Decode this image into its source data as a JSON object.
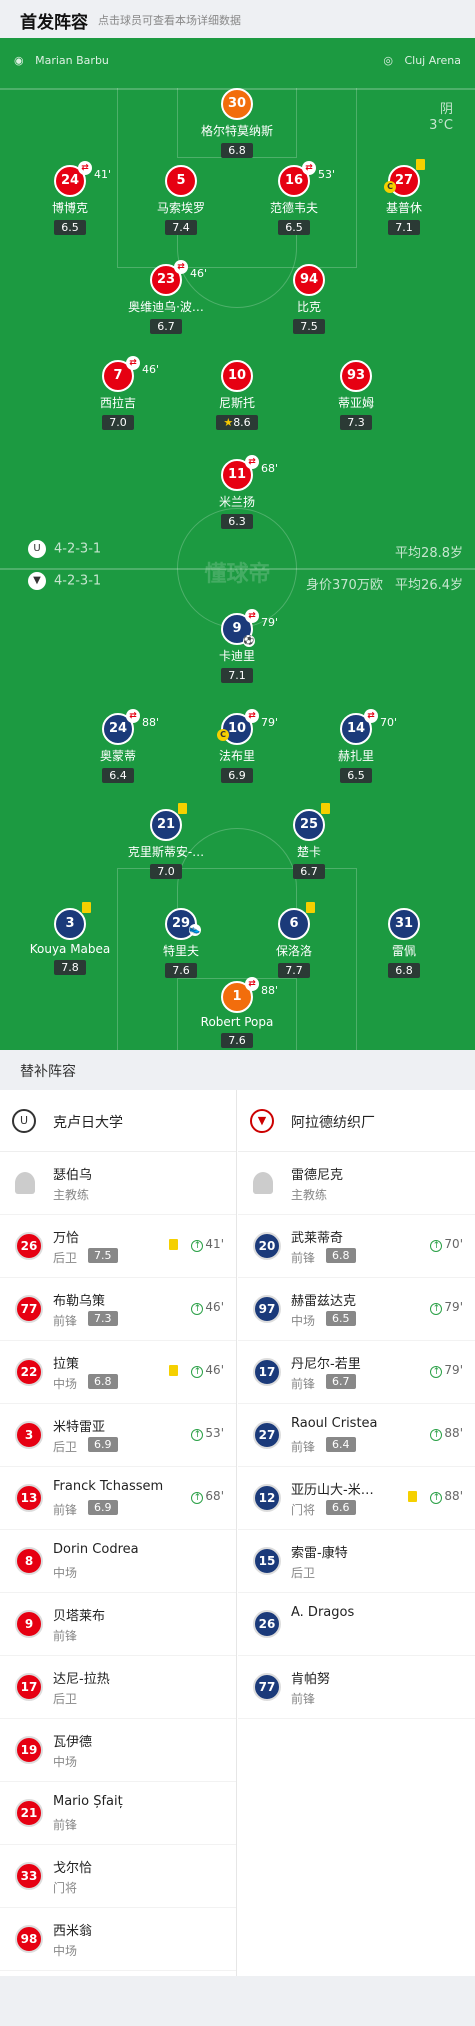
{
  "header": {
    "title": "首发阵容",
    "subtitle": "点击球员可查看本场详细数据"
  },
  "match": {
    "referee": "Marian Barbu",
    "stadium": "Cluj Arena",
    "weather": "阴",
    "temp": "3°C",
    "watermark": "懂球帝"
  },
  "home": {
    "formation": "4-2-3-1",
    "avg_age": "平均28.8岁",
    "name": "克卢日大学",
    "coach": "瑟伯乌",
    "coach_role": "主教练"
  },
  "away": {
    "formation": "4-2-3-1",
    "value": "身价370万欧",
    "avg_age": "平均26.4岁",
    "name": "阿拉德纺织厂",
    "coach": "雷德尼克",
    "coach_role": "主教练"
  },
  "lineup_home": [
    {
      "num": "30",
      "name": "格尔特莫纳斯",
      "rating": "6.8"
    },
    {
      "num": "24",
      "name": "博博克",
      "rating": "6.5",
      "sub_min": "41'"
    },
    {
      "num": "5",
      "name": "马索埃罗",
      "rating": "7.4"
    },
    {
      "num": "16",
      "name": "范德韦夫",
      "rating": "6.5",
      "sub_min": "53'"
    },
    {
      "num": "27",
      "name": "基普休",
      "rating": "7.1",
      "cap": "C"
    },
    {
      "num": "23",
      "name": "奥维迪乌·波…",
      "rating": "6.7",
      "sub_min": "46'"
    },
    {
      "num": "94",
      "name": "比克",
      "rating": "7.5"
    },
    {
      "num": "7",
      "name": "西拉吉",
      "rating": "7.0",
      "sub_min": "46'"
    },
    {
      "num": "10",
      "name": "尼斯托",
      "rating": "8.6"
    },
    {
      "num": "93",
      "name": "蒂亚姆",
      "rating": "7.3"
    },
    {
      "num": "11",
      "name": "米兰扬",
      "rating": "6.3",
      "sub_min": "68'"
    }
  ],
  "lineup_away": [
    {
      "num": "9",
      "name": "卡迪里",
      "rating": "7.1",
      "sub_min": "79'"
    },
    {
      "num": "24",
      "name": "奥蒙蒂",
      "rating": "6.4",
      "sub_min": "88'"
    },
    {
      "num": "10",
      "name": "法布里",
      "rating": "6.9",
      "sub_min": "79'",
      "cap": "C"
    },
    {
      "num": "14",
      "name": "赫扎里",
      "rating": "6.5",
      "sub_min": "70'"
    },
    {
      "num": "21",
      "name": "克里斯蒂安-…",
      "rating": "7.0"
    },
    {
      "num": "25",
      "name": "楚卡",
      "rating": "6.7"
    },
    {
      "num": "3",
      "name": "Kouya Mabea",
      "rating": "7.8"
    },
    {
      "num": "29",
      "name": "特里夫",
      "rating": "7.6"
    },
    {
      "num": "6",
      "name": "保洛洛",
      "rating": "7.7"
    },
    {
      "num": "31",
      "name": "雷佩",
      "rating": "6.8"
    },
    {
      "num": "1",
      "name": "Robert Popa",
      "rating": "7.6",
      "sub_min": "88'"
    }
  ],
  "bench_title": "替补阵容",
  "bench_home": [
    {
      "num": "26",
      "name": "万恰",
      "pos": "后卫",
      "rating": "7.5",
      "min": "41'",
      "yellow": true
    },
    {
      "num": "77",
      "name": "布勒乌策",
      "pos": "前锋",
      "rating": "7.3",
      "min": "46'"
    },
    {
      "num": "22",
      "name": "拉策",
      "pos": "中场",
      "rating": "6.8",
      "min": "46'",
      "yellow": true
    },
    {
      "num": "3",
      "name": "米特雷亚",
      "pos": "后卫",
      "rating": "6.9",
      "min": "53'"
    },
    {
      "num": "13",
      "name": "Franck Tchassem",
      "pos": "前锋",
      "rating": "6.9",
      "min": "68'"
    },
    {
      "num": "8",
      "name": "Dorin Codrea",
      "pos": "中场"
    },
    {
      "num": "9",
      "name": "贝塔莱布",
      "pos": "前锋"
    },
    {
      "num": "17",
      "name": "达尼-拉热",
      "pos": "后卫"
    },
    {
      "num": "19",
      "name": "瓦伊德",
      "pos": "中场"
    },
    {
      "num": "21",
      "name": "Mario Șfaiț",
      "pos": "前锋"
    },
    {
      "num": "33",
      "name": "戈尔恰",
      "pos": "门将"
    },
    {
      "num": "98",
      "name": "西米翁",
      "pos": "中场"
    }
  ],
  "bench_away": [
    {
      "num": "20",
      "name": "武莱蒂奇",
      "pos": "前锋",
      "rating": "6.8",
      "min": "70'"
    },
    {
      "num": "97",
      "name": "赫雷兹达克",
      "pos": "中场",
      "rating": "6.5",
      "min": "79'"
    },
    {
      "num": "17",
      "name": "丹尼尔-若里",
      "pos": "前锋",
      "rating": "6.7",
      "min": "79'"
    },
    {
      "num": "27",
      "name": "Raoul Cristea",
      "pos": "前锋",
      "rating": "6.4",
      "min": "88'"
    },
    {
      "num": "12",
      "name": "亚历山大-米…",
      "pos": "门将",
      "rating": "6.6",
      "min": "88'",
      "yellow": true
    },
    {
      "num": "15",
      "name": "索雷-康特",
      "pos": "后卫"
    },
    {
      "num": "26",
      "name": "A. Dragos",
      "pos": ""
    },
    {
      "num": "77",
      "name": "肯帕努",
      "pos": "前锋"
    }
  ]
}
